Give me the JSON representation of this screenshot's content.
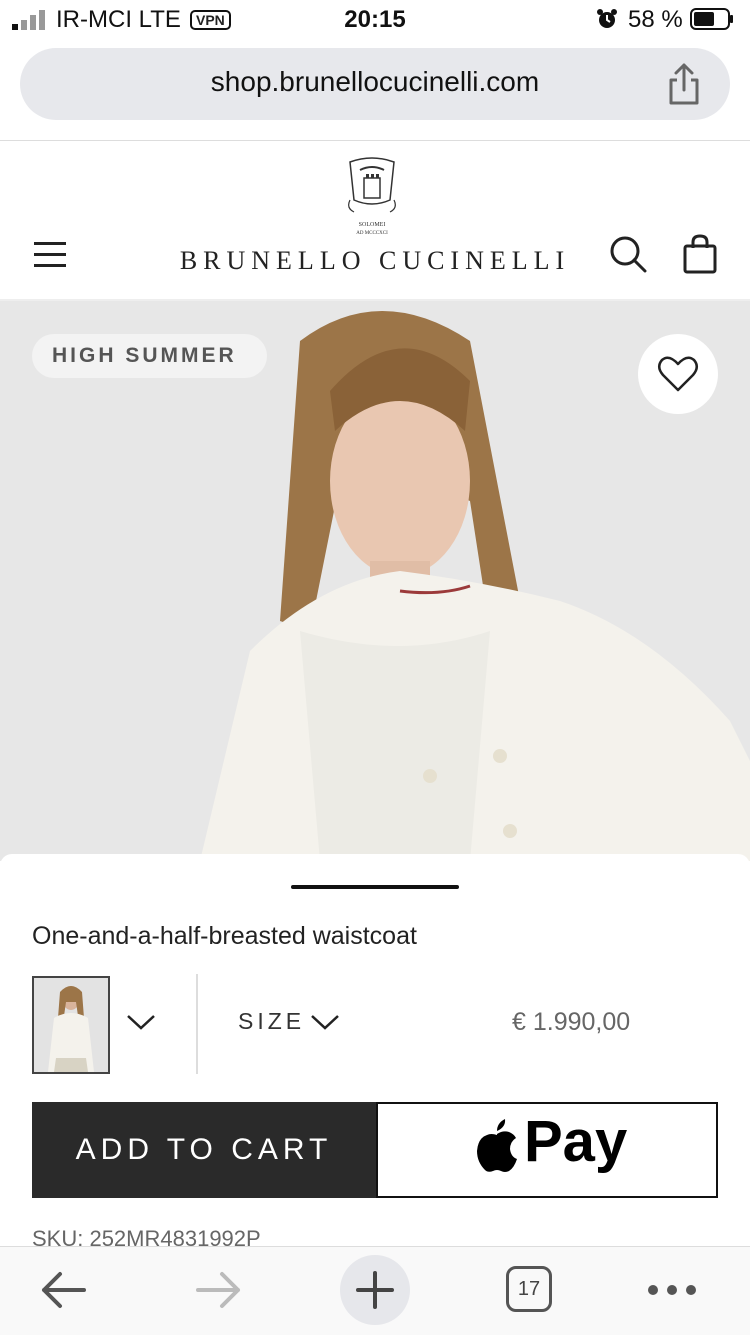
{
  "status_bar": {
    "carrier": "IR-MCI  LTE",
    "vpn": "VPN",
    "time": "20:15",
    "battery": "58 %"
  },
  "browser": {
    "url": "shop.brunellocucinelli.com",
    "tab_count": "17"
  },
  "site": {
    "brand": "BRUNELLO CUCINELLI",
    "emblem_text_1": "SOLOMEI",
    "emblem_text_2": "AD MCCCXCI"
  },
  "hero": {
    "badge": "HIGH SUMMER"
  },
  "product": {
    "title": "One-and-a-half-breasted waistcoat",
    "size_label": "SIZE",
    "price": "€ 1.990,00",
    "add_to_cart": "ADD TO CART",
    "apple_pay": "Pay",
    "sku": "SKU: 252MR4831992P"
  }
}
